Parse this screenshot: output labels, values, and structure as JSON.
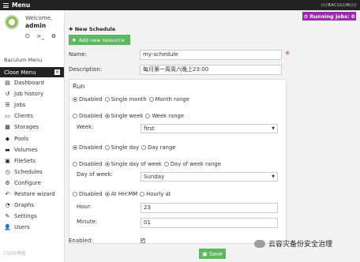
{
  "topbar": {
    "menu_label": "Menu",
    "brand": "////BACULUM////"
  },
  "sidebar": {
    "welcome": "Welcome,",
    "username": "admin",
    "menu_heading": "Baculum Menu",
    "close_menu": "Close Menu",
    "items": [
      {
        "label": "Dashboard",
        "icon": "dashboard-icon",
        "glyph": "▤"
      },
      {
        "label": "Job history",
        "icon": "history-icon",
        "glyph": "↺"
      },
      {
        "label": "Jobs",
        "icon": "list-icon",
        "glyph": "☰"
      },
      {
        "label": "Clients",
        "icon": "desktop-icon",
        "glyph": "▭"
      },
      {
        "label": "Storages",
        "icon": "database-icon",
        "glyph": "▦"
      },
      {
        "label": "Pools",
        "icon": "cubes-icon",
        "glyph": "◆"
      },
      {
        "label": "Volumes",
        "icon": "hdd-icon",
        "glyph": "▬"
      },
      {
        "label": "FileSets",
        "icon": "files-icon",
        "glyph": "▣"
      },
      {
        "label": "Schedules",
        "icon": "clock-icon",
        "glyph": "◷"
      },
      {
        "label": "Configure",
        "icon": "cog-icon",
        "glyph": "⚙"
      },
      {
        "label": "Restore wizard",
        "icon": "reply-icon",
        "glyph": "↶"
      },
      {
        "label": "Graphs",
        "icon": "chart-icon",
        "glyph": "◔"
      },
      {
        "label": "Settings",
        "icon": "wrench-icon",
        "glyph": "✎"
      },
      {
        "label": "Users",
        "icon": "users-icon",
        "glyph": "👤"
      }
    ]
  },
  "running_jobs": "Running jobs: 0",
  "form": {
    "heading": "New Schedule",
    "add_resource": "Add new resource",
    "name_label": "Name:",
    "name_value": "my-schedule",
    "description_label": "Description:",
    "description_value": "每月第一周周六晚上23:00",
    "run_title": "Run",
    "month_options": [
      "Disabled",
      "Single month",
      "Month range"
    ],
    "week_options": [
      "Disabled",
      "Single week",
      "Week range"
    ],
    "week_label": "Week:",
    "week_value": "first",
    "day_options": [
      "Disabled",
      "Single day",
      "Day range"
    ],
    "dow_options": [
      "Disabled",
      "Single day of week",
      "Day of week range"
    ],
    "dow_label": "Day of week:",
    "dow_value": "Sunday",
    "time_options": [
      "Disabled",
      "At HH:MM",
      "Hourly at"
    ],
    "hour_label": "Hour:",
    "hour_value": "23",
    "minute_label": "Minute:",
    "minute_value": "01",
    "enabled_label": "Enabled:",
    "enabled_checked": true,
    "save_label": "Save"
  },
  "watermarks": {
    "left": "CSDN博客",
    "right": "云容灾备份安全治理"
  },
  "colors": {
    "green": "#5cb85c",
    "purple": "#9c27b0",
    "dark": "#222222",
    "required": "#e53935"
  }
}
